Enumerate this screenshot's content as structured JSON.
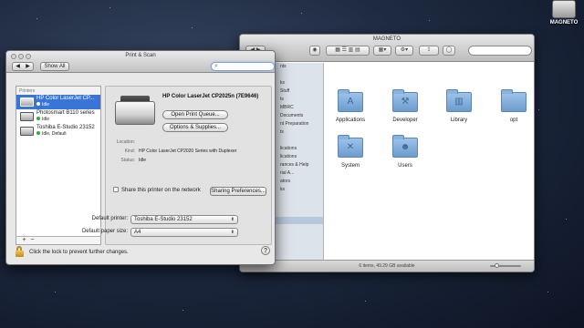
{
  "desktop": {
    "disk_label": "MAGNETO"
  },
  "finder": {
    "title": "MAGNETO",
    "sidebar_fragments": [
      "nts",
      "",
      "ks",
      "Stuff",
      "ts",
      "MBRC",
      "Documents",
      "nt Preparation",
      "ts",
      "",
      "lications",
      "lications",
      "rances & Help",
      "rial A...",
      "ators",
      "ks",
      "",
      "",
      ""
    ],
    "folders": [
      {
        "name": "Applications",
        "icon": "applications-folder-icon",
        "glyph": "A"
      },
      {
        "name": "Developer",
        "icon": "developer-folder-icon",
        "glyph": "⚒"
      },
      {
        "name": "Library",
        "icon": "library-folder-icon",
        "glyph": "▥"
      },
      {
        "name": "opt",
        "icon": "folder-icon",
        "glyph": ""
      },
      {
        "name": "System",
        "icon": "system-folder-icon",
        "glyph": "✕"
      },
      {
        "name": "Users",
        "icon": "users-folder-icon",
        "glyph": "☻"
      }
    ],
    "status": "6 items, 49.29 GB available"
  },
  "print_scan": {
    "title": "Print & Scan",
    "nav": {
      "back": "◀",
      "forward": "▶"
    },
    "show_all": "Show All",
    "search_placeholder": "",
    "printers_header": "Printers",
    "printers": [
      {
        "name": "HP Color LaserJet CP...",
        "status": "Idle",
        "selected": true,
        "status_color": "#ffffff"
      },
      {
        "name": "Photosmart B110 series",
        "status": "Idle",
        "selected": false,
        "status_color": "#3aa53a"
      },
      {
        "name": "Toshiba E-Studio 23152",
        "status": "Idle, Default",
        "selected": false,
        "status_color": "#3aa53a"
      }
    ],
    "add_label": "+",
    "remove_label": "−",
    "selected_printer": {
      "name": "HP Color LaserJet CP2025n (7E9646)",
      "open_queue": "Open Print Queue...",
      "options_supplies": "Options & Supplies...",
      "location_label": "Location:",
      "location": "",
      "kind_label": "Kind:",
      "kind": "HP Color LaserJet CP2020 Series with Duplexer",
      "status_label": "Status:",
      "status": "Idle"
    },
    "share_label": "Share this printer on the network",
    "sharing_prefs": "Sharing Preferences...",
    "default_printer_label": "Default printer:",
    "default_printer": "Toshiba E-Studio 23152",
    "default_paper_label": "Default paper size:",
    "default_paper": "A4",
    "lock_text": "Click the lock to prevent further changes.",
    "help": "?"
  },
  "colors": {
    "selection": "#3875d7",
    "status_green": "#3aa53a",
    "lock_gold": "#d9a22a"
  }
}
